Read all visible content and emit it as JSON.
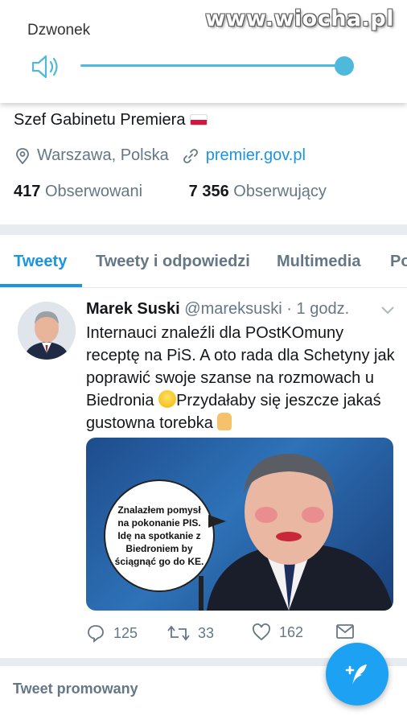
{
  "watermark": "www.wiocha.pl",
  "volume": {
    "title": "Dzwonek",
    "icon": "speaker-icon",
    "level_fraction": 1.0,
    "accent": "#4fb9dc"
  },
  "profile": {
    "bio": "Szef Gabinetu Premiera",
    "flag_icon": "poland-flag-icon",
    "location": "Warszawa, Polska",
    "website": "premier.gov.pl",
    "following_count": "417",
    "following_label": "Obserwowani",
    "followers_count": "7 356",
    "followers_label": "Obserwujący"
  },
  "tabs": [
    {
      "label": "Tweety",
      "active": true
    },
    {
      "label": "Tweety i odpowiedzi",
      "active": false
    },
    {
      "label": "Multimedia",
      "active": false
    },
    {
      "label": "Po",
      "active": false
    }
  ],
  "tweet": {
    "author_name": "Marek Suski",
    "author_handle": "@mareksuski",
    "separator": "·",
    "time": "1 godz.",
    "text_part1": "Internauci znaleźli dla POstKOmuny receptę na PiS. A oto rada dla Schetyny jak poprawić swoje szanse na rozmowach u Biedronia ",
    "emoji1": "laughing-emoji-icon",
    "text_part2": "Przydałaby się jeszcze jakaś gustowna torebka ",
    "emoji2": "thumbs-up-emoji-icon",
    "media": {
      "bubble_text": "Znalazłem pomysł na pokonanie PIS. Idę na spotkanie z Biedroniem by ściągnąć go do KE."
    },
    "replies": "125",
    "retweets": "33",
    "likes": "162"
  },
  "promoted_label": "Tweet promowany",
  "colors": {
    "brand": "#1b95e0",
    "fab": "#1da1f2",
    "muted": "#657786",
    "divider": "#e6ecf0"
  }
}
